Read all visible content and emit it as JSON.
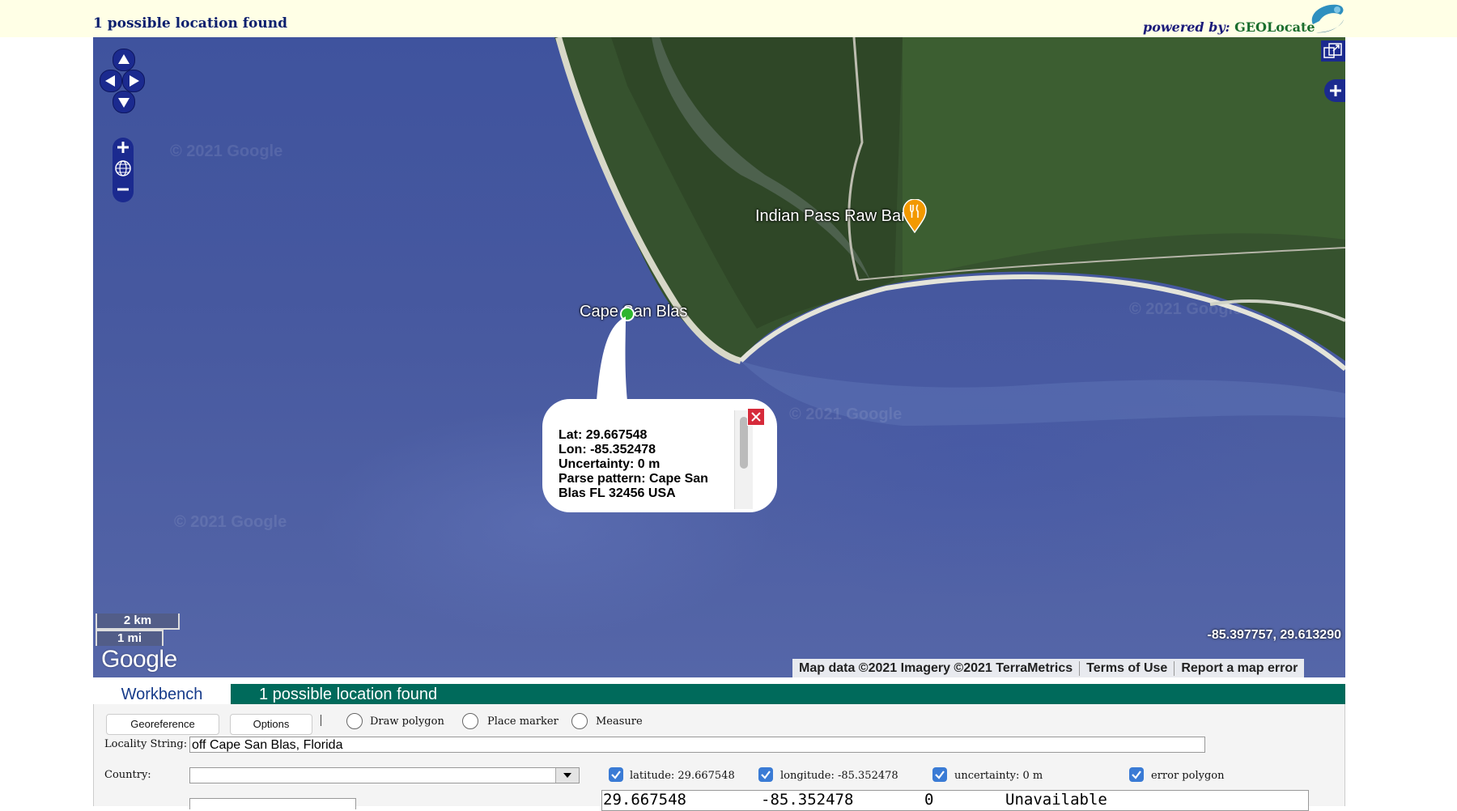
{
  "header": {
    "status": "1 possible location found",
    "powered_by_label": "powered by:",
    "powered_by_brand": "GEOLocate"
  },
  "map": {
    "watermark": "© 2021 Google",
    "labels": {
      "poi": "Indian Pass Raw Bar",
      "place": "Cape San Blas"
    },
    "popup": {
      "lat": "Lat: 29.667548",
      "lon": "Lon: -85.352478",
      "uncertainty": "Uncertainty: 0 m",
      "parse_line1": "Parse pattern: Cape San",
      "parse_line2": "Blas FL 32456 USA"
    },
    "scale": {
      "km": "2 km",
      "mi": "1 mi"
    },
    "google_logo": "Google",
    "cursor_coords": "-85.397757, 29.613290",
    "attribution": {
      "map_data": "Map data ©2021 Imagery ©2021 TerraMetrics",
      "terms": "Terms of Use",
      "report": "Report a map error"
    },
    "icons": [
      "pan-up-icon",
      "pan-left-icon",
      "pan-right-icon",
      "pan-down-icon",
      "zoom-in-icon",
      "globe-icon",
      "zoom-out-icon",
      "fullscreen-icon",
      "layers-plus-icon",
      "restaurant-pin-icon",
      "location-marker-icon",
      "close-icon"
    ]
  },
  "tabs": {
    "workbench": "Workbench",
    "results": "1 possible location found"
  },
  "workbench": {
    "georeference_btn": "Georeference",
    "options_btn": "Options",
    "draw_polygon": "Draw polygon",
    "place_marker": "Place marker",
    "measure": "Measure",
    "locality_label": "Locality String:",
    "locality_value": "off Cape San Blas, Florida",
    "country_label": "Country:",
    "country_value": "",
    "checks": {
      "latitude": "latitude: 29.667548",
      "longitude": "longitude: -85.352478",
      "uncertainty": "uncertainty: 0 m",
      "error_polygon": "error polygon"
    },
    "result_row": {
      "lat": "29.667548",
      "lon": "-85.352478",
      "uncert": "0",
      "polygon": "Unavailable"
    }
  },
  "colors": {
    "accent_teal": "#006a5b",
    "control_blue": "#1b2a8f",
    "header_bg": "#ffffe6",
    "checkbox_blue": "#3a7bd5"
  }
}
